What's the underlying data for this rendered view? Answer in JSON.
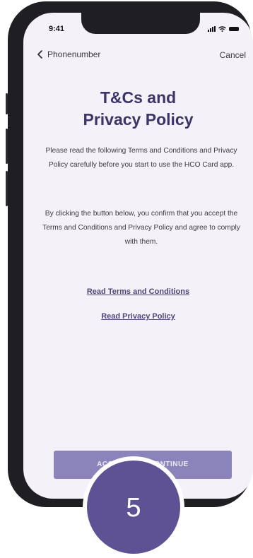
{
  "status_bar": {
    "time": "9:41"
  },
  "nav": {
    "back_label": "Phonenumber",
    "cancel_label": "Cancel"
  },
  "content": {
    "title_line1": "T&Cs and",
    "title_line2": "Privacy Policy",
    "paragraph1": "Please read the following Terms and Conditions and Privacy Policy carefully before you start to use the HCO Card app.",
    "paragraph2": "By clicking the button below, you confirm that you accept the Terms and Conditions and Privacy Policy and agree to comply with them.",
    "link_terms": "Read Terms and Conditions",
    "link_privacy": "Read Privacy Policy"
  },
  "cta": {
    "label": "ACCEPT AND CONTINUE"
  },
  "step_badge": {
    "number": "5"
  },
  "colors": {
    "accent": "#3d3567",
    "button": "#8a84ba",
    "badge": "#5e5295"
  }
}
